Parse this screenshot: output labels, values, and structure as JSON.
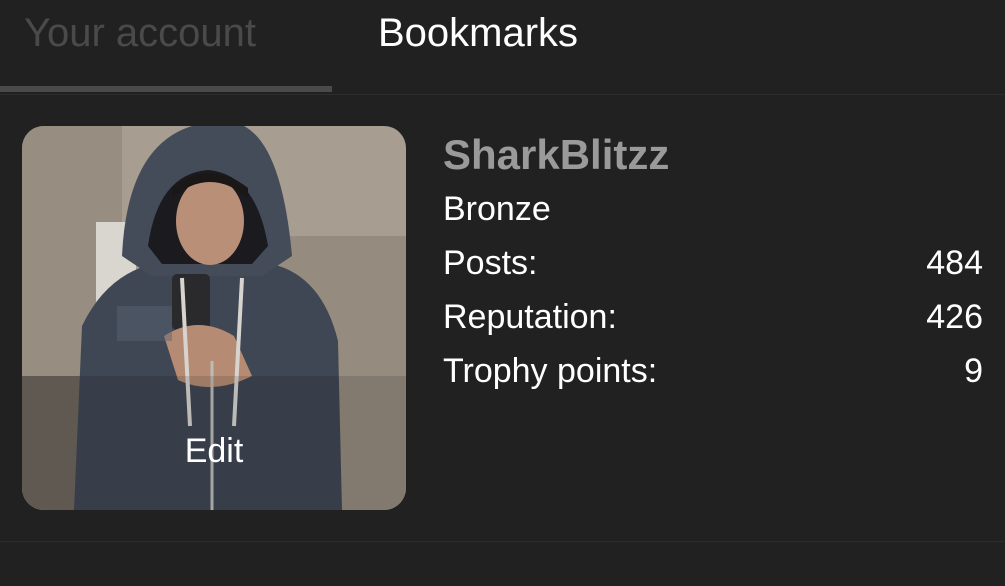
{
  "tabs": {
    "account_label": "Your account",
    "bookmarks_label": "Bookmarks"
  },
  "profile": {
    "username": "SharkBlitzz",
    "rank": "Bronze",
    "edit_label": "Edit",
    "stats": {
      "posts_label": "Posts:",
      "posts_value": "484",
      "reputation_label": "Reputation:",
      "reputation_value": "426",
      "trophy_label": "Trophy points:",
      "trophy_value": "9"
    }
  },
  "colors": {
    "background": "#212121",
    "inactive_text": "#4a4a4a",
    "username_text": "#9a9a9a",
    "primary_text": "#ffffff"
  }
}
